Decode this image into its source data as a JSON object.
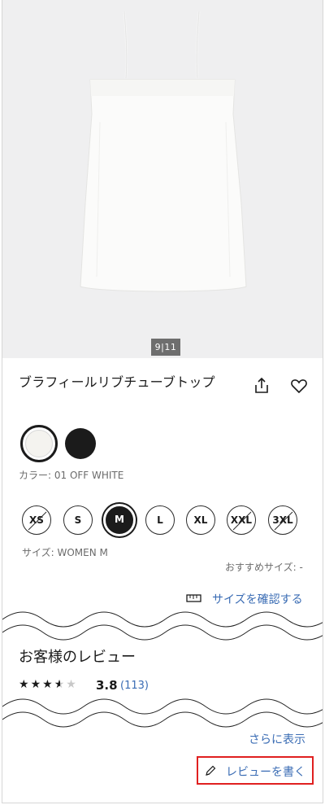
{
  "product": {
    "image_pager": "9|11",
    "title": "ブラフィールリブチューブトップ"
  },
  "actions": {
    "share_icon": "share-icon",
    "favorite_icon": "heart-icon"
  },
  "color": {
    "swatches": [
      {
        "name": "OFF WHITE",
        "hex": "#f4f3ef",
        "selected": true
      },
      {
        "name": "BLACK",
        "hex": "#1b1b1b",
        "selected": false
      }
    ],
    "label": "カラー: 01 OFF WHITE"
  },
  "size": {
    "options": [
      {
        "label": "XS",
        "available": false
      },
      {
        "label": "S",
        "available": true
      },
      {
        "label": "M",
        "available": true,
        "selected": true
      },
      {
        "label": "L",
        "available": true
      },
      {
        "label": "XL",
        "available": true
      },
      {
        "label": "XXL",
        "available": false
      },
      {
        "label": "3XL",
        "available": false
      }
    ],
    "label": "サイズ: WOMEN M",
    "recommended": "おすすめサイズ: -",
    "check_link": "サイズを確認する"
  },
  "reviews": {
    "heading": "お客様のレビュー",
    "rating_value": 3.8,
    "rating": "3.8",
    "count": "(113)",
    "more_link": "さらに表示",
    "write_label": "レビューを書く"
  },
  "colors": {
    "accent_link": "#3a6cb4",
    "highlight_border": "#e02020"
  }
}
